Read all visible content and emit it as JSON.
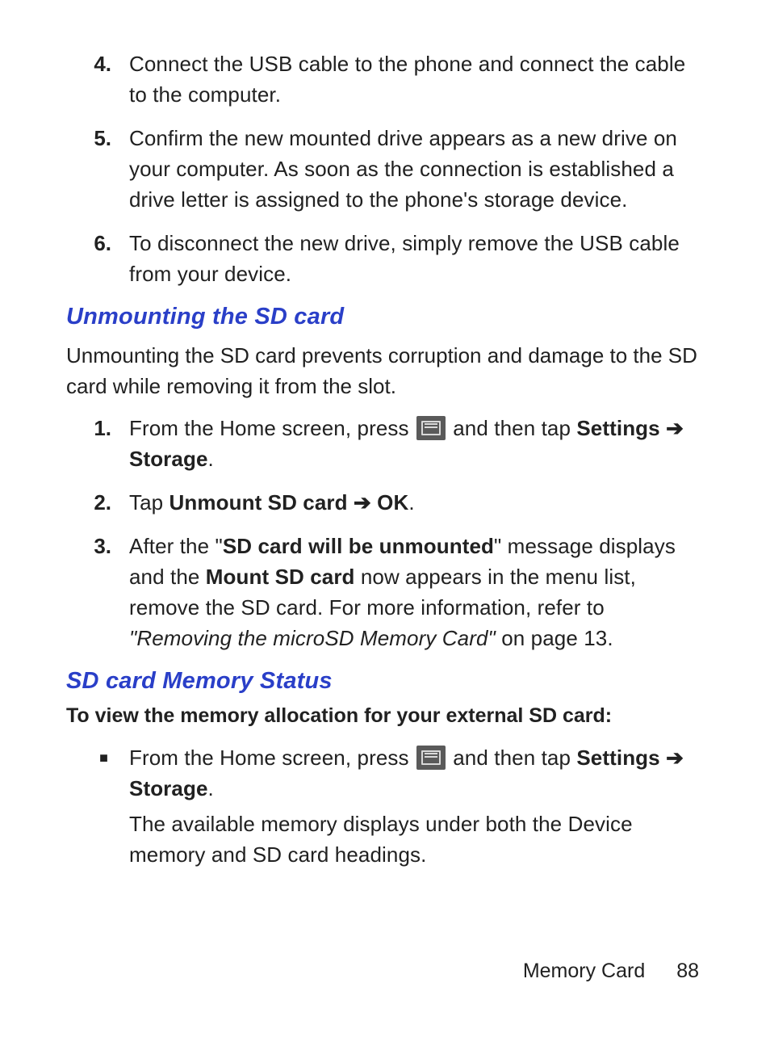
{
  "top_list": [
    {
      "num": "4.",
      "text": "Connect the USB cable to the phone and connect the cable to the computer."
    },
    {
      "num": "5.",
      "text": "Confirm the new mounted drive appears as a new drive on your computer. As soon as the connection is established a drive letter is assigned to the phone's storage device."
    },
    {
      "num": "6.",
      "text": "To disconnect the new drive, simply remove the USB cable from your device."
    }
  ],
  "section1": {
    "heading": "Unmounting the SD card",
    "intro": "Unmounting the SD card prevents corruption and damage to the SD card while removing it from the slot.",
    "steps": {
      "s1": {
        "num": "1.",
        "pre": "From the Home screen, press ",
        "post1": " and then tap ",
        "settings": "Settings",
        "arrow": " ➔ ",
        "storage": "Storage",
        "end": "."
      },
      "s2": {
        "num": "2.",
        "pre": "Tap ",
        "unmount": "Unmount SD card",
        "arrow": " ➔ ",
        "ok": "OK",
        "end": "."
      },
      "s3": {
        "num": "3.",
        "pre": "After the \"",
        "msg": "SD card will be unmounted",
        "mid1": "\" message displays and the ",
        "mount": "Mount SD card",
        "mid2": " now appears in the menu list, remove the SD card. For more information, refer to ",
        "ref": "\"Removing the microSD Memory Card\"",
        "tail": "  on page 13."
      }
    }
  },
  "section2": {
    "heading": "SD card Memory Status",
    "lead": "To view the memory allocation for your external SD card:",
    "bullet": {
      "pre": "From the Home screen, press ",
      "post1": " and then tap ",
      "settings": "Settings",
      "arrow": " ➔ ",
      "storage": "Storage",
      "end": ".",
      "line2": "The available memory displays under both the Device memory and SD card headings."
    }
  },
  "footer": {
    "section": "Memory Card",
    "page": "88"
  }
}
